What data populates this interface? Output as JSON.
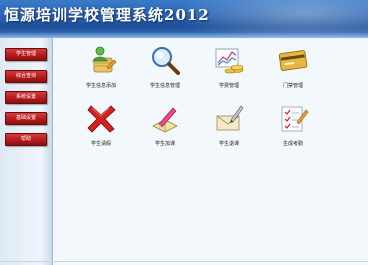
{
  "header": {
    "title": "恒源培训学校管理系统2012"
  },
  "sidebar": {
    "items": [
      {
        "label": "学生管理"
      },
      {
        "label": "综合查询"
      },
      {
        "label": "系统设置"
      },
      {
        "label": "基础设置"
      },
      {
        "label": "帮助"
      }
    ]
  },
  "main": {
    "tiles": [
      {
        "label": "学生信息添加",
        "icon": "user-add-icon"
      },
      {
        "label": "学生信息管理",
        "icon": "magnifier-icon"
      },
      {
        "label": "学费管理",
        "icon": "chart-money-icon"
      },
      {
        "label": "门禁管理",
        "icon": "card-icon"
      },
      {
        "label": "学生请假",
        "icon": "red-x-icon"
      },
      {
        "label": "学生加课",
        "icon": "pencil-book-icon"
      },
      {
        "label": "学生退课",
        "icon": "envelope-pen-icon"
      },
      {
        "label": "生成考勤",
        "icon": "checklist-icon"
      }
    ]
  }
}
